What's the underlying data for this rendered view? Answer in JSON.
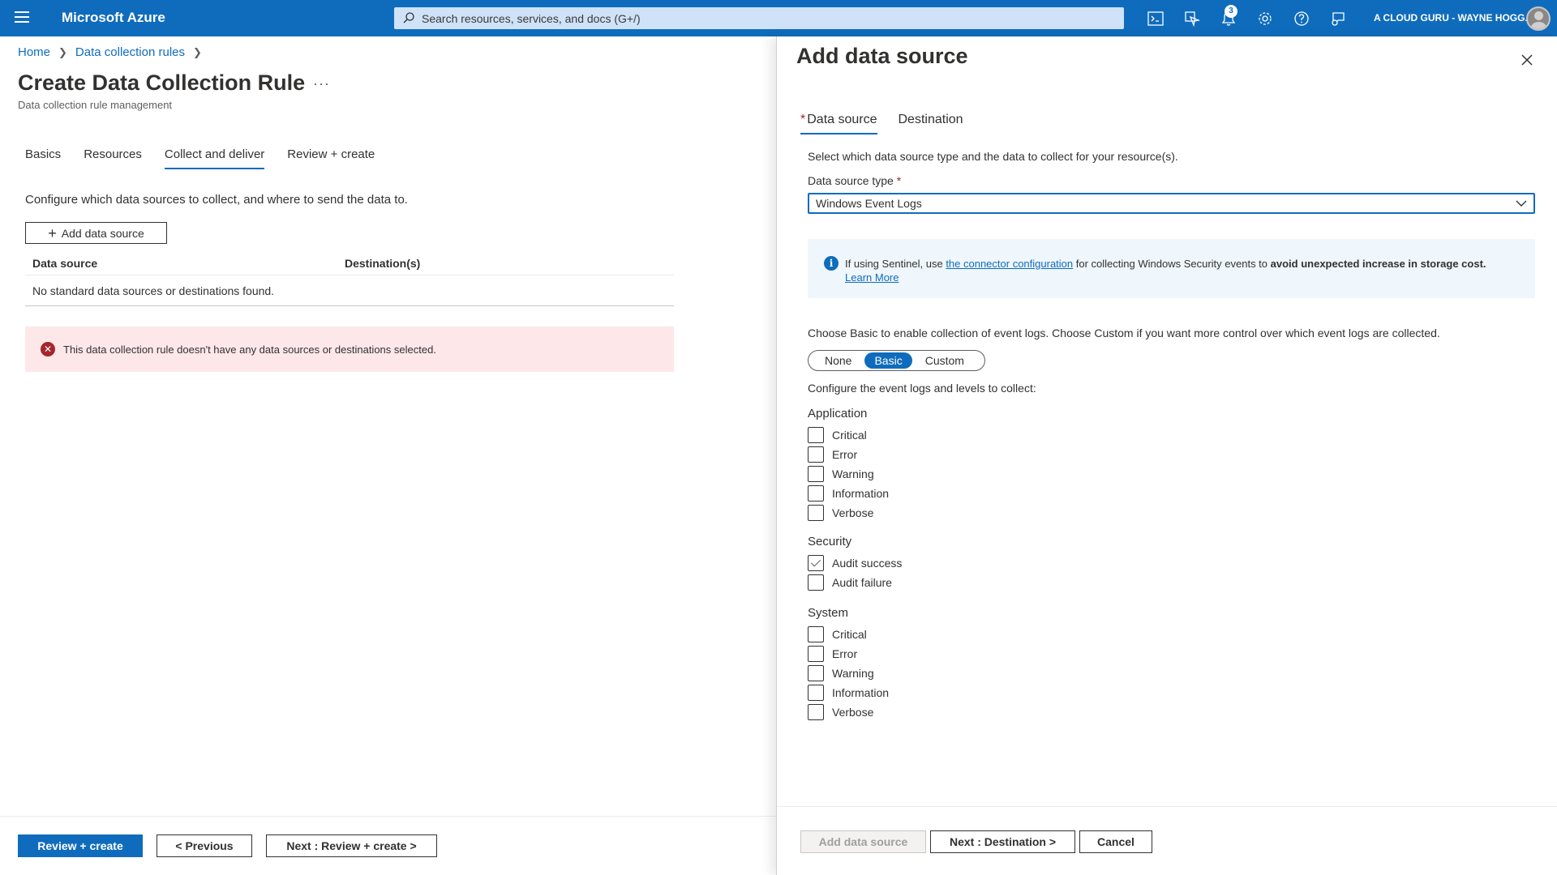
{
  "topbar": {
    "brand": "Microsoft Azure",
    "search_placeholder": "Search resources, services, and docs (G+/)",
    "notification_count": "3",
    "account": "A CLOUD GURU - WAYNE HOGG..."
  },
  "breadcrumb": [
    "Home",
    "Data collection rules"
  ],
  "page": {
    "title": "Create Data Collection Rule",
    "more": "···",
    "subtitle": "Data collection rule management",
    "tabs": [
      "Basics",
      "Resources",
      "Collect and deliver",
      "Review + create"
    ],
    "active_tab": "Collect and deliver",
    "config_text": "Configure which data sources to collect, and where to send the data to.",
    "add_button": "Add data source",
    "table": {
      "headers": [
        "Data source",
        "Destination(s)"
      ],
      "empty_text": "No standard data sources or destinations found."
    },
    "error_message": "This data collection rule doesn't have any data sources or destinations selected.",
    "footer": {
      "review_create": "Review + create",
      "previous": "< Previous",
      "next": "Next : Review + create >"
    }
  },
  "panel": {
    "title": "Add data source",
    "tabs": {
      "data_source": "Data source",
      "destination": "Destination"
    },
    "required_mark": "*",
    "intro": "Select which data source type and the data to collect for your resource(s).",
    "type_label": "Data source type",
    "type_value": "Windows Event Logs",
    "info": {
      "prefix": "If using Sentinel, use ",
      "link": "the connector configuration",
      "middle": " for collecting Windows Security events to ",
      "bold": "avoid unexpected increase in storage cost.",
      "learn_more": "Learn More"
    },
    "choose_text": "Choose Basic to enable collection of event logs. Choose Custom if you want more control over which event logs are collected.",
    "modes": [
      "None",
      "Basic",
      "Custom"
    ],
    "selected_mode": "Basic",
    "configure_text": "Configure the event logs and levels to collect:",
    "groups": {
      "application": {
        "title": "Application",
        "items": [
          "Critical",
          "Error",
          "Warning",
          "Information",
          "Verbose"
        ]
      },
      "security": {
        "title": "Security",
        "items": [
          "Audit success",
          "Audit failure"
        ]
      },
      "system": {
        "title": "System",
        "items": [
          "Critical",
          "Error",
          "Warning",
          "Information",
          "Verbose"
        ]
      }
    },
    "footer": {
      "add": "Add data source",
      "next": "Next : Destination >",
      "cancel": "Cancel"
    }
  },
  "colors": {
    "accent": "#0f6cbd",
    "error": "#a4262c",
    "error_bg": "#fde7e9",
    "info_bg": "#eff6fc"
  }
}
